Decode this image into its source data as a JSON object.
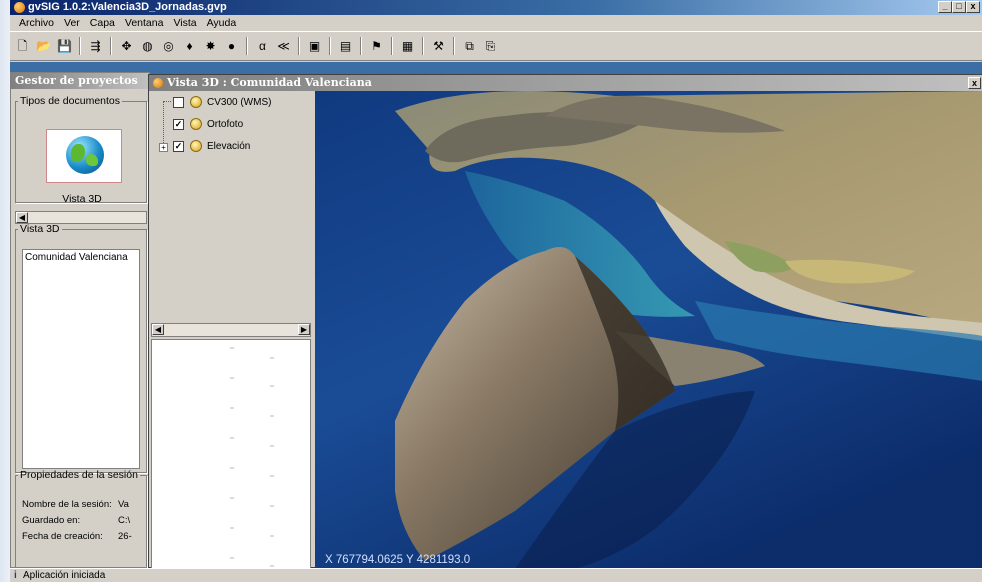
{
  "window": {
    "title": "gvSIG 1.0.2:Valencia3D_Jornadas.gvp",
    "min": "_",
    "max": "□",
    "close": "x"
  },
  "menu": [
    "Archivo",
    "Ver",
    "Capa",
    "Ventana",
    "Vista",
    "Ayuda"
  ],
  "toolbar": [
    {
      "name": "new-project-icon",
      "glyph": "🗋"
    },
    {
      "name": "open-project-icon",
      "glyph": "📂"
    },
    {
      "name": "save-project-icon",
      "glyph": "💾"
    },
    {
      "name": "sep"
    },
    {
      "name": "add-layer-icon",
      "glyph": "⇶"
    },
    {
      "name": "sep"
    },
    {
      "name": "pan-icon",
      "glyph": "✥"
    },
    {
      "name": "zoom-globe-icon",
      "glyph": "◍"
    },
    {
      "name": "zoom-target-icon",
      "glyph": "◎"
    },
    {
      "name": "navigation-icon",
      "glyph": "♦"
    },
    {
      "name": "tool-icon",
      "glyph": "✸"
    },
    {
      "name": "globe-icon",
      "glyph": "●"
    },
    {
      "name": "sep"
    },
    {
      "name": "alpha-icon",
      "glyph": "α"
    },
    {
      "name": "measure-icon",
      "glyph": "≪"
    },
    {
      "name": "sep"
    },
    {
      "name": "layout-icon",
      "glyph": "▣"
    },
    {
      "name": "sep"
    },
    {
      "name": "frame-icon",
      "glyph": "▤"
    },
    {
      "name": "sep"
    },
    {
      "name": "flag-icon",
      "glyph": "⚑"
    },
    {
      "name": "sep"
    },
    {
      "name": "select-icon",
      "glyph": "▦"
    },
    {
      "name": "sep"
    },
    {
      "name": "settings-icon",
      "glyph": "⚒"
    },
    {
      "name": "sep"
    },
    {
      "name": "copy-icon",
      "glyph": "⧉"
    },
    {
      "name": "pdf-icon",
      "glyph": "⎘"
    }
  ],
  "gestor": {
    "title": "Gestor de proyectos",
    "tipos_label": "Tipos de documentos",
    "doc_label": "Vista 3D",
    "vista_group_label": "Vista 3D",
    "vistas": [
      "Comunidad Valenciana"
    ],
    "props_label": "Propiedades de la sesión",
    "props": [
      {
        "label": "Nombre de la sesión:",
        "value": "Va"
      },
      {
        "label": "Guardado en:",
        "value": "C:\\"
      },
      {
        "label": "Fecha de creación:",
        "value": "26-"
      }
    ]
  },
  "vista": {
    "title": "Vista 3D : Comunidad Valenciana",
    "close": "x",
    "layers": [
      {
        "name": "CV300 (WMS)",
        "checked": false
      },
      {
        "name": "Ortofoto",
        "checked": true
      },
      {
        "name": "Elevación",
        "checked": true
      }
    ],
    "checkmark": "✓",
    "coords": "X  767794.0625 Y  4281193.0"
  },
  "status": {
    "icon": "i",
    "text": "Aplicación iniciada"
  },
  "colors": {
    "workspace": "#3a6ea5",
    "sea": "#0f3a8a",
    "land": "#a89a70"
  }
}
